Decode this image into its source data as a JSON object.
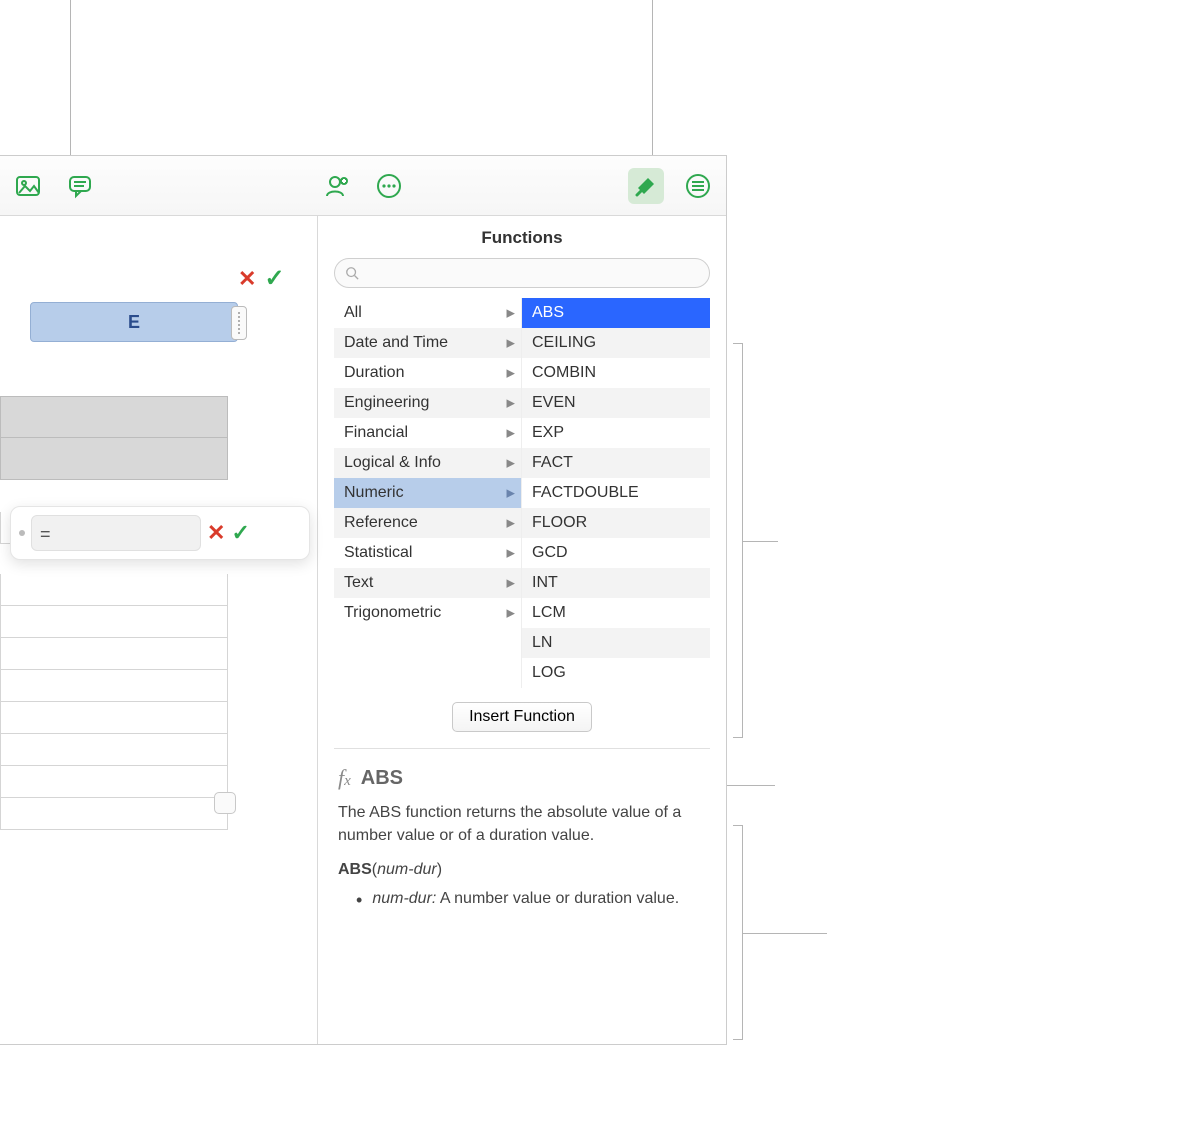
{
  "sidebar_title": "Functions",
  "column_header": "E",
  "formula_value": "=",
  "search": {
    "placeholder": ""
  },
  "categories": [
    "All",
    "Date and Time",
    "Duration",
    "Engineering",
    "Financial",
    "Logical & Info",
    "Numeric",
    "Reference",
    "Statistical",
    "Text",
    "Trigonometric"
  ],
  "selected_category_index": 6,
  "functions": [
    "ABS",
    "CEILING",
    "COMBIN",
    "EVEN",
    "EXP",
    "FACT",
    "FACTDOUBLE",
    "FLOOR",
    "GCD",
    "INT",
    "LCM",
    "LN",
    "LOG"
  ],
  "selected_function_index": 0,
  "insert_button_label": "Insert Function",
  "help": {
    "name": "ABS",
    "description": "The ABS function returns the absolute value of a number value or of a duration value.",
    "signature_fn": "ABS",
    "signature_arg": "num-dur",
    "param_name": "num-dur",
    "param_desc": "A number value or duration value."
  }
}
